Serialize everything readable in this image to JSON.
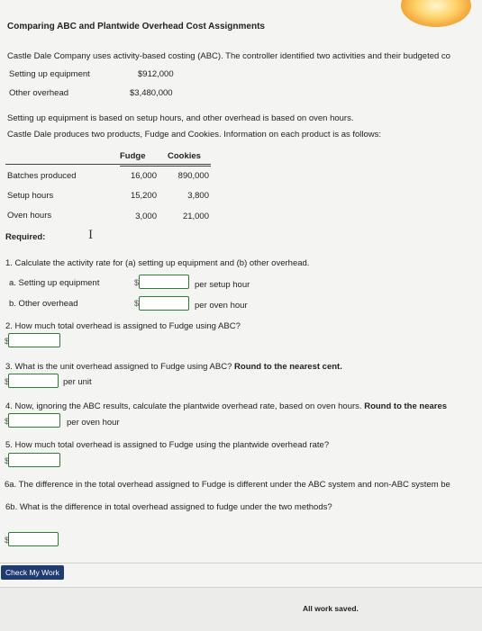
{
  "title": "Comparing ABC and Plantwide Overhead Cost Assignments",
  "intro": "Castle Dale Company uses activity-based costing (ABC). The controller identified two activities and their budgeted co",
  "activities": [
    {
      "name": "Setting up equipment",
      "amount": "$912,000"
    },
    {
      "name": "Other overhead",
      "amount": "$3,480,000"
    }
  ],
  "basis_text": "Setting up equipment is based on setup hours, and other overhead is based on oven hours.",
  "products_text": "Castle Dale produces two products, Fudge and Cookies. Information on each product is as follows:",
  "table": {
    "headers": [
      "Fudge",
      "Cookies"
    ],
    "rows": [
      {
        "label": "Batches produced",
        "fudge": "16,000",
        "cookies": "890,000"
      },
      {
        "label": "Setup hours",
        "fudge": "15,200",
        "cookies": "3,800"
      },
      {
        "label": "Oven hours",
        "fudge": "3,000",
        "cookies": "21,000"
      }
    ]
  },
  "required_label": "Required:",
  "q1": {
    "text": "1. Calculate the activity rate for (a) setting up equipment and (b) other overhead.",
    "a_label": "a. Setting up equipment",
    "a_value": "",
    "a_unit": "per setup hour",
    "b_label": "b. Other overhead",
    "b_value": "",
    "b_unit": "per oven hour"
  },
  "q2": {
    "text": "2. How much total overhead is assigned to Fudge using ABC?",
    "value": ""
  },
  "q3": {
    "text_plain": "3. What is the unit overhead assigned to Fudge using ABC?",
    "text_bold": "Round to the nearest cent.",
    "value": "",
    "unit": "per unit"
  },
  "q4": {
    "text_plain": "4. Now, ignoring the ABC results, calculate the plantwide overhead rate, based on oven hours.",
    "text_bold": "Round to the neares",
    "value": "",
    "unit": "per oven hour"
  },
  "q5": {
    "text": "5. How much total overhead is assigned to Fudge using the plantwide overhead rate?",
    "value": ""
  },
  "q6a": {
    "text": "6a. The difference in the total overhead assigned to Fudge is different under the ABC system and non-ABC system be"
  },
  "q6b": {
    "text": "6b. What is the difference in total overhead assigned to fudge under the two methods?",
    "value": ""
  },
  "currency_symbol": "$",
  "check_button": "Check My Work",
  "status": "All work saved."
}
